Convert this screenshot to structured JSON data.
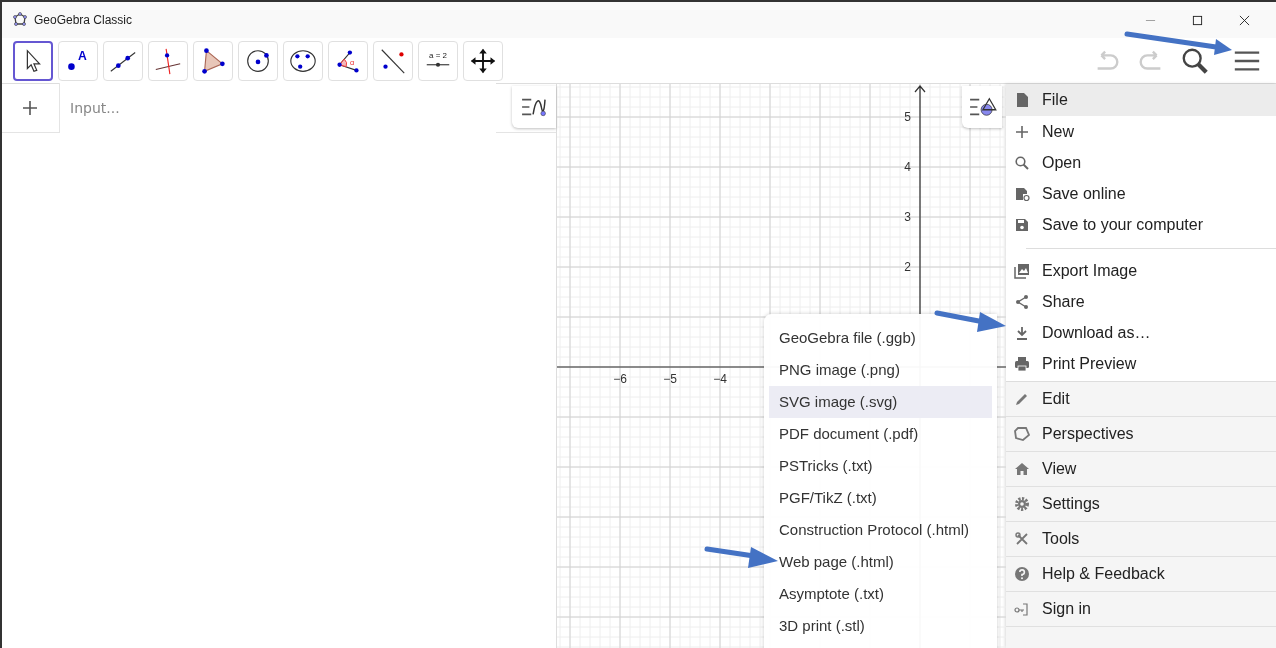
{
  "window": {
    "title": "GeoGebra Classic"
  },
  "toolbar": {
    "tools": [
      {
        "selected": true
      },
      {
        "selected": false,
        "glyph": "A"
      },
      {
        "selected": false
      },
      {
        "selected": false
      },
      {
        "selected": false
      },
      {
        "selected": false
      },
      {
        "selected": false
      },
      {
        "selected": false,
        "glyph": "α"
      },
      {
        "selected": false
      },
      {
        "selected": false,
        "glyph": "a = 2"
      },
      {
        "selected": false
      }
    ],
    "undo": {
      "disabled": true
    },
    "redo": {
      "disabled": true
    }
  },
  "algebra": {
    "input": {
      "placeholder": "Input..."
    }
  },
  "graphics": {
    "x_labels": [
      "−6",
      "−5",
      "−4"
    ],
    "y_labels": [
      "5",
      "4",
      "3",
      "2"
    ]
  },
  "menu": {
    "file": {
      "label": "File",
      "expanded": true
    },
    "file_groups": [
      [
        {
          "label": "New"
        },
        {
          "label": "Open"
        },
        {
          "label": "Save online"
        },
        {
          "label": "Save to your computer"
        }
      ],
      [
        {
          "label": "Export Image"
        },
        {
          "label": "Share"
        },
        {
          "label": "Download as…"
        },
        {
          "label": "Print Preview"
        }
      ]
    ],
    "sections": [
      {
        "label": "Edit"
      },
      {
        "label": "Perspectives"
      },
      {
        "label": "View"
      },
      {
        "label": "Settings"
      },
      {
        "label": "Tools"
      },
      {
        "label": "Help & Feedback"
      },
      {
        "label": "Sign in"
      }
    ]
  },
  "download_menu": {
    "items": [
      {
        "label": "GeoGebra file (.ggb)",
        "selected": false
      },
      {
        "label": "PNG image (.png)",
        "selected": false
      },
      {
        "label": "SVG image (.svg)",
        "selected": true
      },
      {
        "label": "PDF document (.pdf)",
        "selected": false
      },
      {
        "label": "PSTricks (.txt)",
        "selected": false
      },
      {
        "label": "PGF/TikZ (.txt)",
        "selected": false
      },
      {
        "label": "Construction Protocol (.html)",
        "selected": false
      },
      {
        "label": "Web page (.html)",
        "selected": false
      },
      {
        "label": "Asymptote (.txt)",
        "selected": false
      },
      {
        "label": "3D print (.stl)",
        "selected": false
      }
    ]
  }
}
